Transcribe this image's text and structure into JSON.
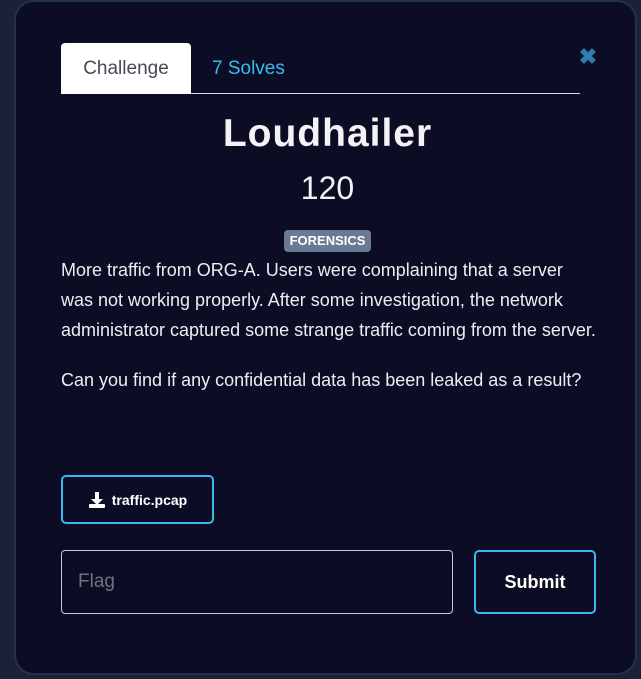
{
  "modal": {
    "tabs": [
      {
        "label": "Challenge"
      },
      {
        "label": "7 Solves"
      }
    ],
    "close_icon": "close-icon"
  },
  "challenge": {
    "title": "Loudhailer",
    "points": "120",
    "category": "FORENSICS",
    "description": [
      "More traffic from ORG-A. Users were complaining that a server was not working properly. After some investigation, the network administrator captured some strange traffic coming from the server.",
      "Can you find if any confidential data has been leaked as a result?"
    ],
    "file": {
      "name": "traffic.pcap",
      "icon": "download-icon"
    }
  },
  "flag_form": {
    "placeholder": "Flag",
    "submit_label": "Submit"
  },
  "colors": {
    "background": "#0c0c24",
    "accent": "#38bdf2",
    "badge": "#6b7a94"
  }
}
